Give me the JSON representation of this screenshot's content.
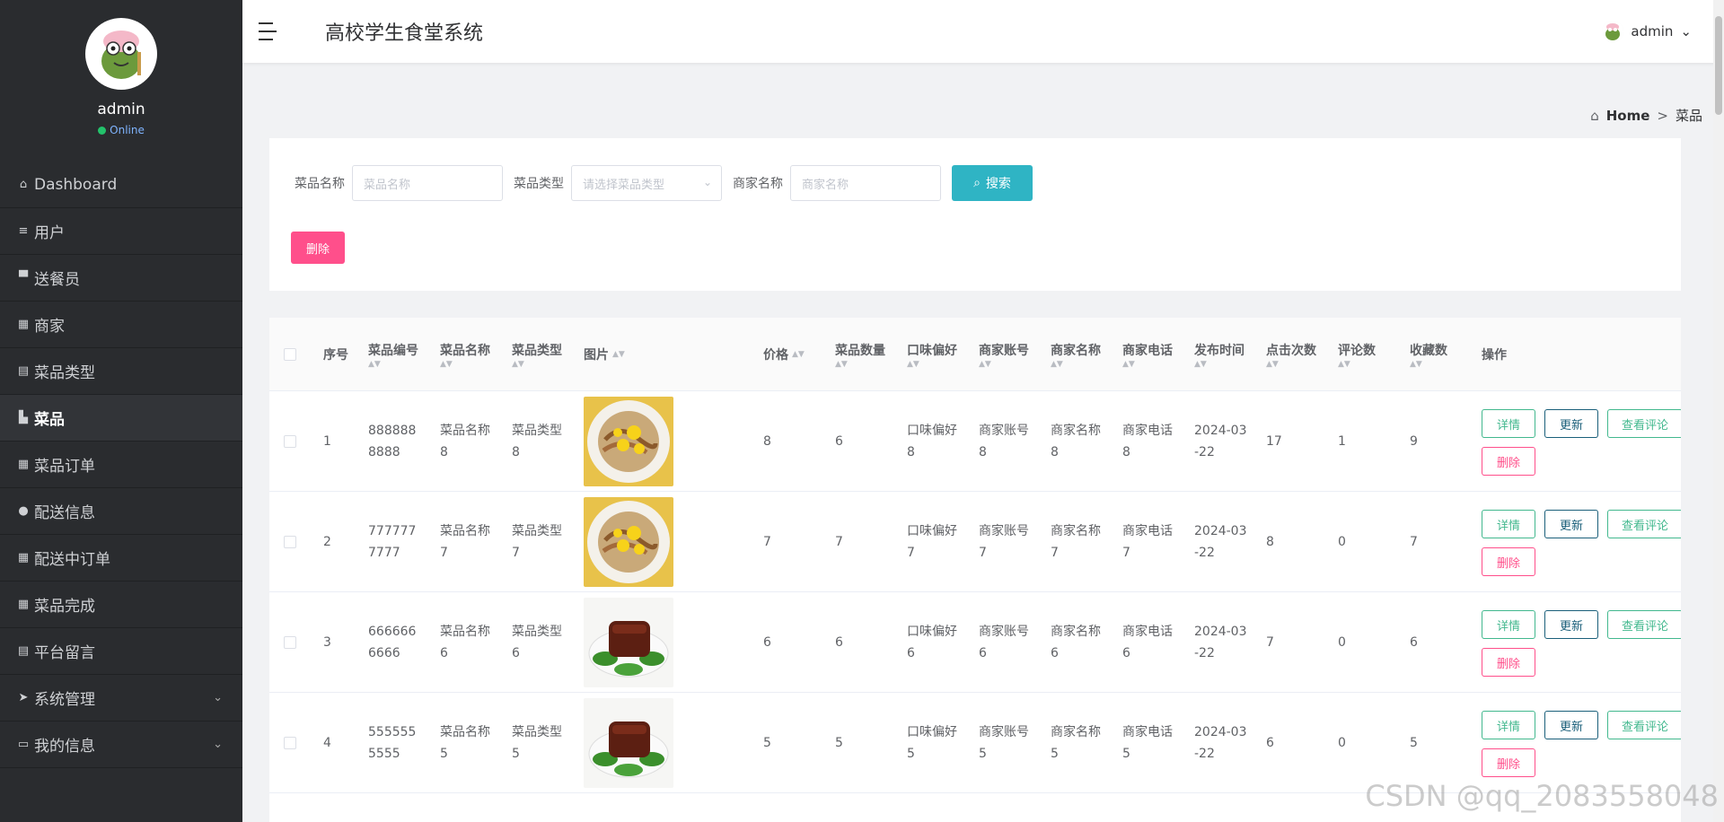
{
  "sidebar": {
    "profile_name": "admin",
    "status": "Online",
    "items": [
      {
        "label": "Dashboard",
        "icon": "home-icon"
      },
      {
        "label": "用户",
        "icon": "list-icon"
      },
      {
        "label": "送餐员",
        "icon": "monitor-icon"
      },
      {
        "label": "商家",
        "icon": "grid-icon"
      },
      {
        "label": "菜品类型",
        "icon": "clipboard-icon"
      },
      {
        "label": "菜品",
        "icon": "book-icon"
      },
      {
        "label": "菜品订单",
        "icon": "grid-icon"
      },
      {
        "label": "配送信息",
        "icon": "pin-icon"
      },
      {
        "label": "配送中订单",
        "icon": "grid-icon"
      },
      {
        "label": "菜品完成",
        "icon": "grid-icon"
      },
      {
        "label": "平台留言",
        "icon": "clipboard-icon"
      },
      {
        "label": "系统管理",
        "icon": "send-icon"
      },
      {
        "label": "我的信息",
        "icon": "card-icon"
      }
    ]
  },
  "header": {
    "title": "高校学生食堂系统",
    "user": "admin"
  },
  "breadcrumb": {
    "home": "Home",
    "separator": ">",
    "current": "菜品"
  },
  "search": {
    "name_label": "菜品名称",
    "name_placeholder": "菜品名称",
    "type_label": "菜品类型",
    "type_placeholder": "请选择菜品类型",
    "merchant_label": "商家名称",
    "merchant_placeholder": "商家名称",
    "search_button": "搜索",
    "delete_button": "删除"
  },
  "table": {
    "headers": {
      "index": "序号",
      "code": "菜品编号",
      "name": "菜品名称",
      "type": "菜品类型",
      "image": "图片",
      "price": "价格",
      "quantity": "菜品数量",
      "taste": "口味偏好",
      "merchant_account": "商家账号",
      "merchant_name": "商家名称",
      "merchant_phone": "商家电话",
      "publish_time": "发布时间",
      "clicks": "点击次数",
      "comments": "评论数",
      "favorites": "收藏数",
      "actions": "操作"
    },
    "actions": {
      "detail": "详情",
      "update": "更新",
      "view_comments": "查看评论",
      "delete": "删除"
    },
    "rows": [
      {
        "index": "1",
        "code": "8888888888",
        "name": "菜品名称8",
        "type": "菜品类型8",
        "price": "8",
        "quantity": "6",
        "taste": "口味偏好8",
        "merchant_account": "商家账号8",
        "merchant_name": "商家名称8",
        "merchant_phone": "商家电话8",
        "publish_time": "2024-03-22",
        "clicks": "17",
        "comments": "1",
        "favorites": "9",
        "image": "noodles"
      },
      {
        "index": "2",
        "code": "7777777777",
        "name": "菜品名称7",
        "type": "菜品类型7",
        "price": "7",
        "quantity": "7",
        "taste": "口味偏好7",
        "merchant_account": "商家账号7",
        "merchant_name": "商家名称7",
        "merchant_phone": "商家电话7",
        "publish_time": "2024-03-22",
        "clicks": "8",
        "comments": "0",
        "favorites": "7",
        "image": "noodles"
      },
      {
        "index": "3",
        "code": "6666666666",
        "name": "菜品名称6",
        "type": "菜品类型6",
        "price": "6",
        "quantity": "6",
        "taste": "口味偏好6",
        "merchant_account": "商家账号6",
        "merchant_name": "商家名称6",
        "merchant_phone": "商家电话6",
        "publish_time": "2024-03-22",
        "clicks": "7",
        "comments": "0",
        "favorites": "6",
        "image": "pork"
      },
      {
        "index": "4",
        "code": "5555555555",
        "name": "菜品名称5",
        "type": "菜品类型5",
        "price": "5",
        "quantity": "5",
        "taste": "口味偏好5",
        "merchant_account": "商家账号5",
        "merchant_name": "商家名称5",
        "merchant_phone": "商家电话5",
        "publish_time": "2024-03-22",
        "clicks": "6",
        "comments": "0",
        "favorites": "5",
        "image": "pork"
      }
    ]
  },
  "watermark": "CSDN @qq_2083558048",
  "colors": {
    "sidebar_bg": "#2a2c2f",
    "search_button": "#2fb4c4",
    "delete": "#ff4f8b",
    "detail": "#42b88e",
    "update": "#1a5f7a"
  }
}
